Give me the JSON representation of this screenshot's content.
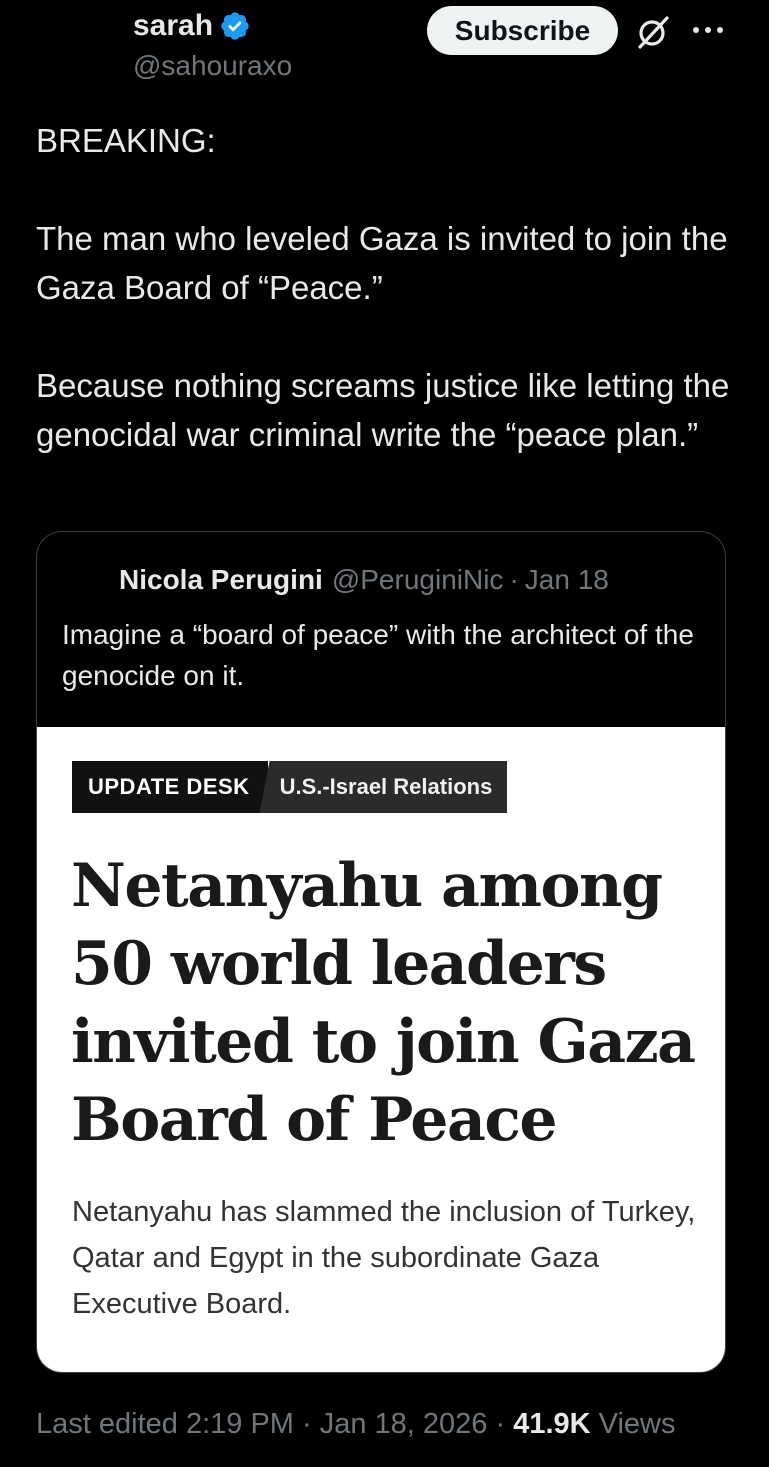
{
  "author": {
    "name": "sarah",
    "handle": "@sahouraxo",
    "verified": true
  },
  "header": {
    "subscribe_label": "Subscribe",
    "grok_icon": "grok-slash-icon",
    "more_icon": "more-horizontal-icon"
  },
  "tweet": {
    "paragraphs": [
      "BREAKING:",
      "The man who leveled Gaza is invited to join the Gaza Board of “Peace.”",
      "Because nothing screams justice like letting the genocidal war criminal write the “peace plan.”"
    ]
  },
  "quote": {
    "author_name": "Nicola Perugini",
    "author_handle": "@PeruginiNic",
    "separator": "·",
    "date": "Jan 18",
    "text": "Imagine a “board of peace” with the architect of the genocide on it.",
    "article": {
      "tag_primary": "UPDATE DESK",
      "tag_secondary": "U.S.-Israel Relations",
      "headline": "Netanyahu among 50 world leaders invited to join Gaza Board of Peace",
      "subheadline": "Netanyahu has slammed the inclusion of Turkey, Qatar and Egypt in the subordinate Gaza Executive Board."
    }
  },
  "meta": {
    "edited_prefix": "Last edited 2:19 PM",
    "separator": " · ",
    "date": "Jan 18, 2026",
    "views_count": "41.9K",
    "views_label": "Views"
  },
  "colors": {
    "background": "#000000",
    "text_primary": "#e7e9ea",
    "text_secondary": "#71767b",
    "verified_blue": "#1d9bf0"
  }
}
